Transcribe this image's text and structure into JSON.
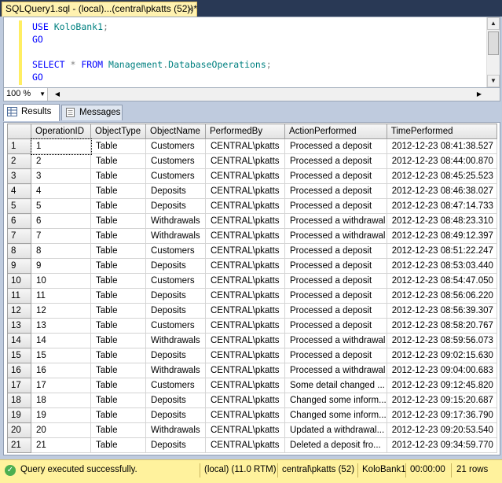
{
  "tab": {
    "title": "SQLQuery1.sql - (local)...(central\\pkatts (52))*",
    "close_glyph": "×"
  },
  "editor": {
    "lines": [
      [
        {
          "t": "USE ",
          "c": "kw"
        },
        {
          "t": "KoloBank1",
          "c": "id"
        },
        {
          "t": ";",
          "c": "op"
        }
      ],
      [
        {
          "t": "GO",
          "c": "kw"
        }
      ],
      [],
      [
        {
          "t": "SELECT ",
          "c": "kw"
        },
        {
          "t": "* ",
          "c": "op"
        },
        {
          "t": "FROM ",
          "c": "kw"
        },
        {
          "t": "Management",
          "c": "id"
        },
        {
          "t": ".",
          "c": "op"
        },
        {
          "t": "DatabaseOperations",
          "c": "id"
        },
        {
          "t": ";",
          "c": "op"
        }
      ],
      [
        {
          "t": "GO",
          "c": "kw"
        }
      ]
    ]
  },
  "zoom": {
    "value": "100 %"
  },
  "result_tabs": {
    "results": "Results",
    "messages": "Messages"
  },
  "grid": {
    "columns": [
      "OperationID",
      "ObjectType",
      "ObjectName",
      "PerformedBy",
      "ActionPerformed",
      "TimePerformed"
    ],
    "rows": [
      [
        "1",
        "1",
        "Table",
        "Customers",
        "CENTRAL\\pkatts",
        "Processed a deposit",
        "2012-12-23 08:41:38.527"
      ],
      [
        "2",
        "2",
        "Table",
        "Customers",
        "CENTRAL\\pkatts",
        "Processed a deposit",
        "2012-12-23 08:44:00.870"
      ],
      [
        "3",
        "3",
        "Table",
        "Customers",
        "CENTRAL\\pkatts",
        "Processed a deposit",
        "2012-12-23 08:45:25.523"
      ],
      [
        "4",
        "4",
        "Table",
        "Deposits",
        "CENTRAL\\pkatts",
        "Processed a deposit",
        "2012-12-23 08:46:38.027"
      ],
      [
        "5",
        "5",
        "Table",
        "Deposits",
        "CENTRAL\\pkatts",
        "Processed a deposit",
        "2012-12-23 08:47:14.733"
      ],
      [
        "6",
        "6",
        "Table",
        "Withdrawals",
        "CENTRAL\\pkatts",
        "Processed a withdrawal",
        "2012-12-23 08:48:23.310"
      ],
      [
        "7",
        "7",
        "Table",
        "Withdrawals",
        "CENTRAL\\pkatts",
        "Processed a withdrawal",
        "2012-12-23 08:49:12.397"
      ],
      [
        "8",
        "8",
        "Table",
        "Customers",
        "CENTRAL\\pkatts",
        "Processed a deposit",
        "2012-12-23 08:51:22.247"
      ],
      [
        "9",
        "9",
        "Table",
        "Deposits",
        "CENTRAL\\pkatts",
        "Processed a deposit",
        "2012-12-23 08:53:03.440"
      ],
      [
        "10",
        "10",
        "Table",
        "Customers",
        "CENTRAL\\pkatts",
        "Processed a deposit",
        "2012-12-23 08:54:47.050"
      ],
      [
        "11",
        "11",
        "Table",
        "Deposits",
        "CENTRAL\\pkatts",
        "Processed a deposit",
        "2012-12-23 08:56:06.220"
      ],
      [
        "12",
        "12",
        "Table",
        "Deposits",
        "CENTRAL\\pkatts",
        "Processed a deposit",
        "2012-12-23 08:56:39.307"
      ],
      [
        "13",
        "13",
        "Table",
        "Customers",
        "CENTRAL\\pkatts",
        "Processed a deposit",
        "2012-12-23 08:58:20.767"
      ],
      [
        "14",
        "14",
        "Table",
        "Withdrawals",
        "CENTRAL\\pkatts",
        "Processed a withdrawal",
        "2012-12-23 08:59:56.073"
      ],
      [
        "15",
        "15",
        "Table",
        "Deposits",
        "CENTRAL\\pkatts",
        "Processed a deposit",
        "2012-12-23 09:02:15.630"
      ],
      [
        "16",
        "16",
        "Table",
        "Withdrawals",
        "CENTRAL\\pkatts",
        "Processed a withdrawal",
        "2012-12-23 09:04:00.683"
      ],
      [
        "17",
        "17",
        "Table",
        "Customers",
        "CENTRAL\\pkatts",
        "Some detail changed ...",
        "2012-12-23 09:12:45.820"
      ],
      [
        "18",
        "18",
        "Table",
        "Deposits",
        "CENTRAL\\pkatts",
        "Changed some inform...",
        "2012-12-23 09:15:20.687"
      ],
      [
        "19",
        "19",
        "Table",
        "Deposits",
        "CENTRAL\\pkatts",
        "Changed some inform...",
        "2012-12-23 09:17:36.790"
      ],
      [
        "20",
        "20",
        "Table",
        "Withdrawals",
        "CENTRAL\\pkatts",
        "Updated a withdrawal...",
        "2012-12-23 09:20:53.540"
      ],
      [
        "21",
        "21",
        "Table",
        "Deposits",
        "CENTRAL\\pkatts",
        "Deleted a deposit fro...",
        "2012-12-23 09:34:59.770"
      ]
    ]
  },
  "status": {
    "message": "Query executed successfully.",
    "server": "(local) (11.0 RTM)",
    "user": "central\\pkatts (52)",
    "database": "KoloBank1",
    "elapsed": "00:00:00",
    "rows": "21 rows"
  },
  "colors": {
    "status_bg": "#fff29d",
    "tab_bg": "#fff2b0",
    "frame": "#293955"
  }
}
